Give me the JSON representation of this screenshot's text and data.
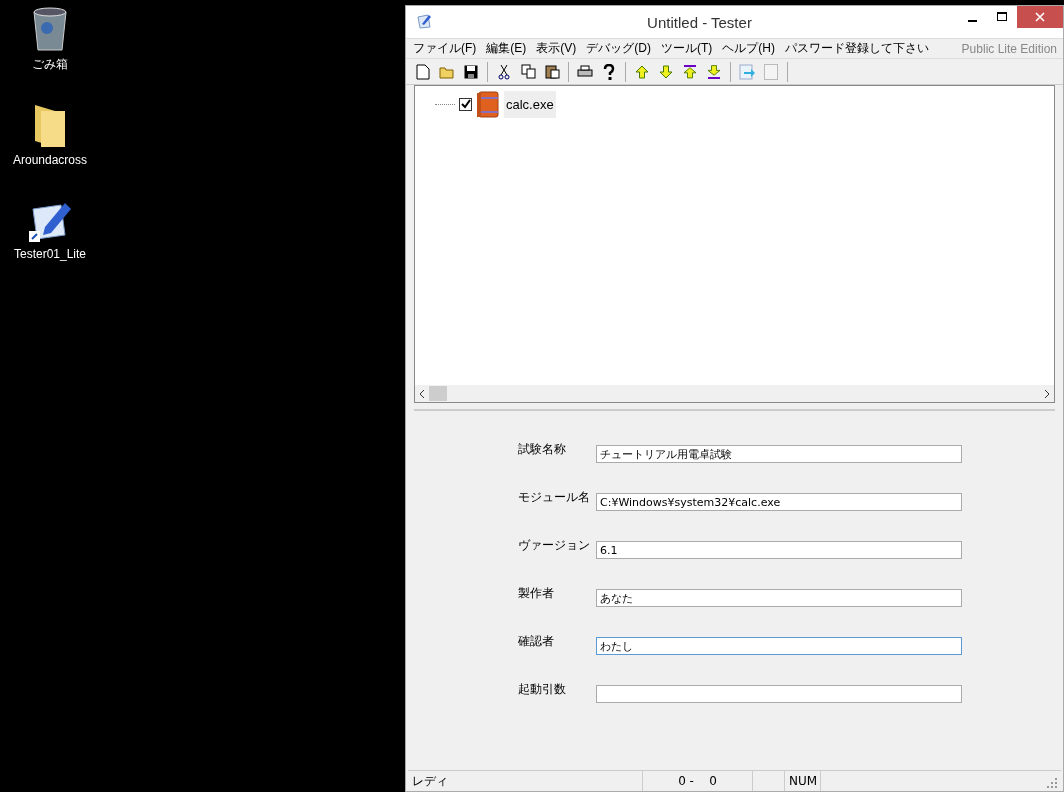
{
  "desktop_icons": [
    {
      "label": "ごみ箱",
      "kind": "trash"
    },
    {
      "label": "Aroundacross",
      "kind": "folder"
    },
    {
      "label": "Tester01_Lite",
      "kind": "shortcut"
    }
  ],
  "window": {
    "title": "Untitled - Tester"
  },
  "menu": [
    {
      "label": "ファイル(F)"
    },
    {
      "label": "編集(E)"
    },
    {
      "label": "表示(V)"
    },
    {
      "label": "デバッグ(D)"
    },
    {
      "label": "ツール(T)"
    },
    {
      "label": "ヘルプ(H)"
    },
    {
      "label": "パスワード登録して下さい"
    }
  ],
  "edition": "Public Lite Edition",
  "tree": [
    {
      "label": "calc.exe",
      "checked": true,
      "selected": true
    }
  ],
  "form": [
    {
      "label": "試験名称",
      "value": "チュートリアル用電卓試験",
      "focused": false
    },
    {
      "label": "モジュール名",
      "value": "C:¥Windows¥system32¥calc.exe",
      "focused": false
    },
    {
      "label": "ヴァージョン",
      "value": "6.1",
      "focused": false
    },
    {
      "label": "製作者",
      "value": "あなた",
      "focused": false
    },
    {
      "label": "確認者",
      "value": "わたし",
      "focused": true
    },
    {
      "label": "起動引数",
      "focused": false
    }
  ],
  "status_bar": {
    "message": "レディ",
    "position": "0 -    0",
    "num": "NUM"
  }
}
